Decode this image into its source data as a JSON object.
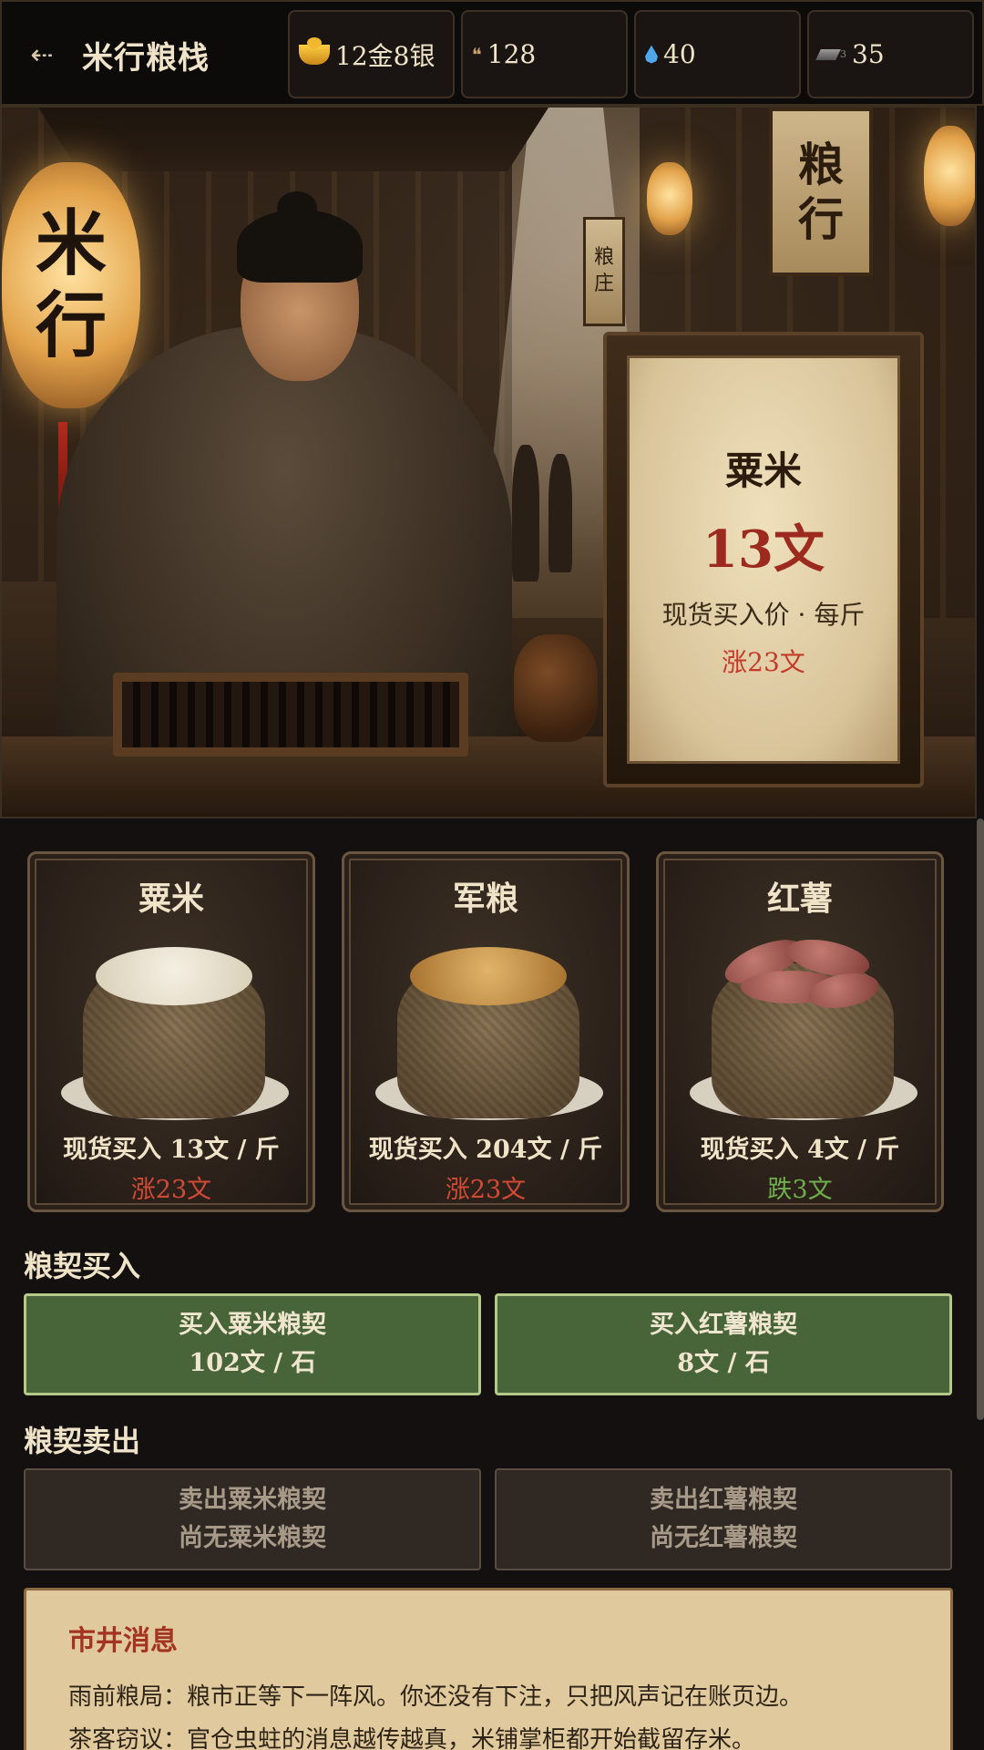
{
  "header": {
    "back_icon": "back-arrow-icon",
    "title": "米行粮栈",
    "resources": [
      {
        "icon": "gold-ingot-icon",
        "value": "12金8银"
      },
      {
        "icon": "grain-icon",
        "value": "128"
      },
      {
        "icon": "water-drop-icon",
        "value": "40"
      },
      {
        "icon": "iron-ingot-icon",
        "sub": "3",
        "value": "35"
      }
    ]
  },
  "hero": {
    "lantern_text": [
      "米",
      "行"
    ],
    "sign_text": [
      "粮",
      "行"
    ],
    "small_sign_text": [
      "粮",
      "庄"
    ],
    "board": {
      "name": "粟米",
      "price": "13文",
      "desc": "现货买入价 · 每斤",
      "change": "涨23文"
    }
  },
  "cards": [
    {
      "name": "粟米",
      "price": "现货买入 13文 / 斤",
      "change": "涨23文",
      "trend": "up"
    },
    {
      "name": "军粮",
      "price": "现货买入 204文 / 斤",
      "change": "涨23文",
      "trend": "up"
    },
    {
      "name": "红薯",
      "price": "现货买入 4文 / 斤",
      "change": "跌3文",
      "trend": "down"
    }
  ],
  "buy_section": {
    "title": "粮契买入",
    "buttons": [
      {
        "label": "买入粟米粮契",
        "sub": "102文 / 石"
      },
      {
        "label": "买入红薯粮契",
        "sub": "8文 / 石"
      }
    ]
  },
  "sell_section": {
    "title": "粮契卖出",
    "buttons": [
      {
        "label": "卖出粟米粮契",
        "sub": "尚无粟米粮契"
      },
      {
        "label": "卖出红薯粮契",
        "sub": "尚无红薯粮契"
      }
    ]
  },
  "news": {
    "title": "市井消息",
    "lines": [
      "雨前粮局：粮市正等下一阵风。你还没有下注，只把风声记在账页边。",
      "茶客窃议：官仓虫蛀的消息越传越真，米铺掌柜都开始截留存米。"
    ]
  },
  "colors": {
    "rise": "#d24a36",
    "fall": "#6fae4c",
    "buy_button": "#48653a",
    "news_title": "#a33421"
  }
}
